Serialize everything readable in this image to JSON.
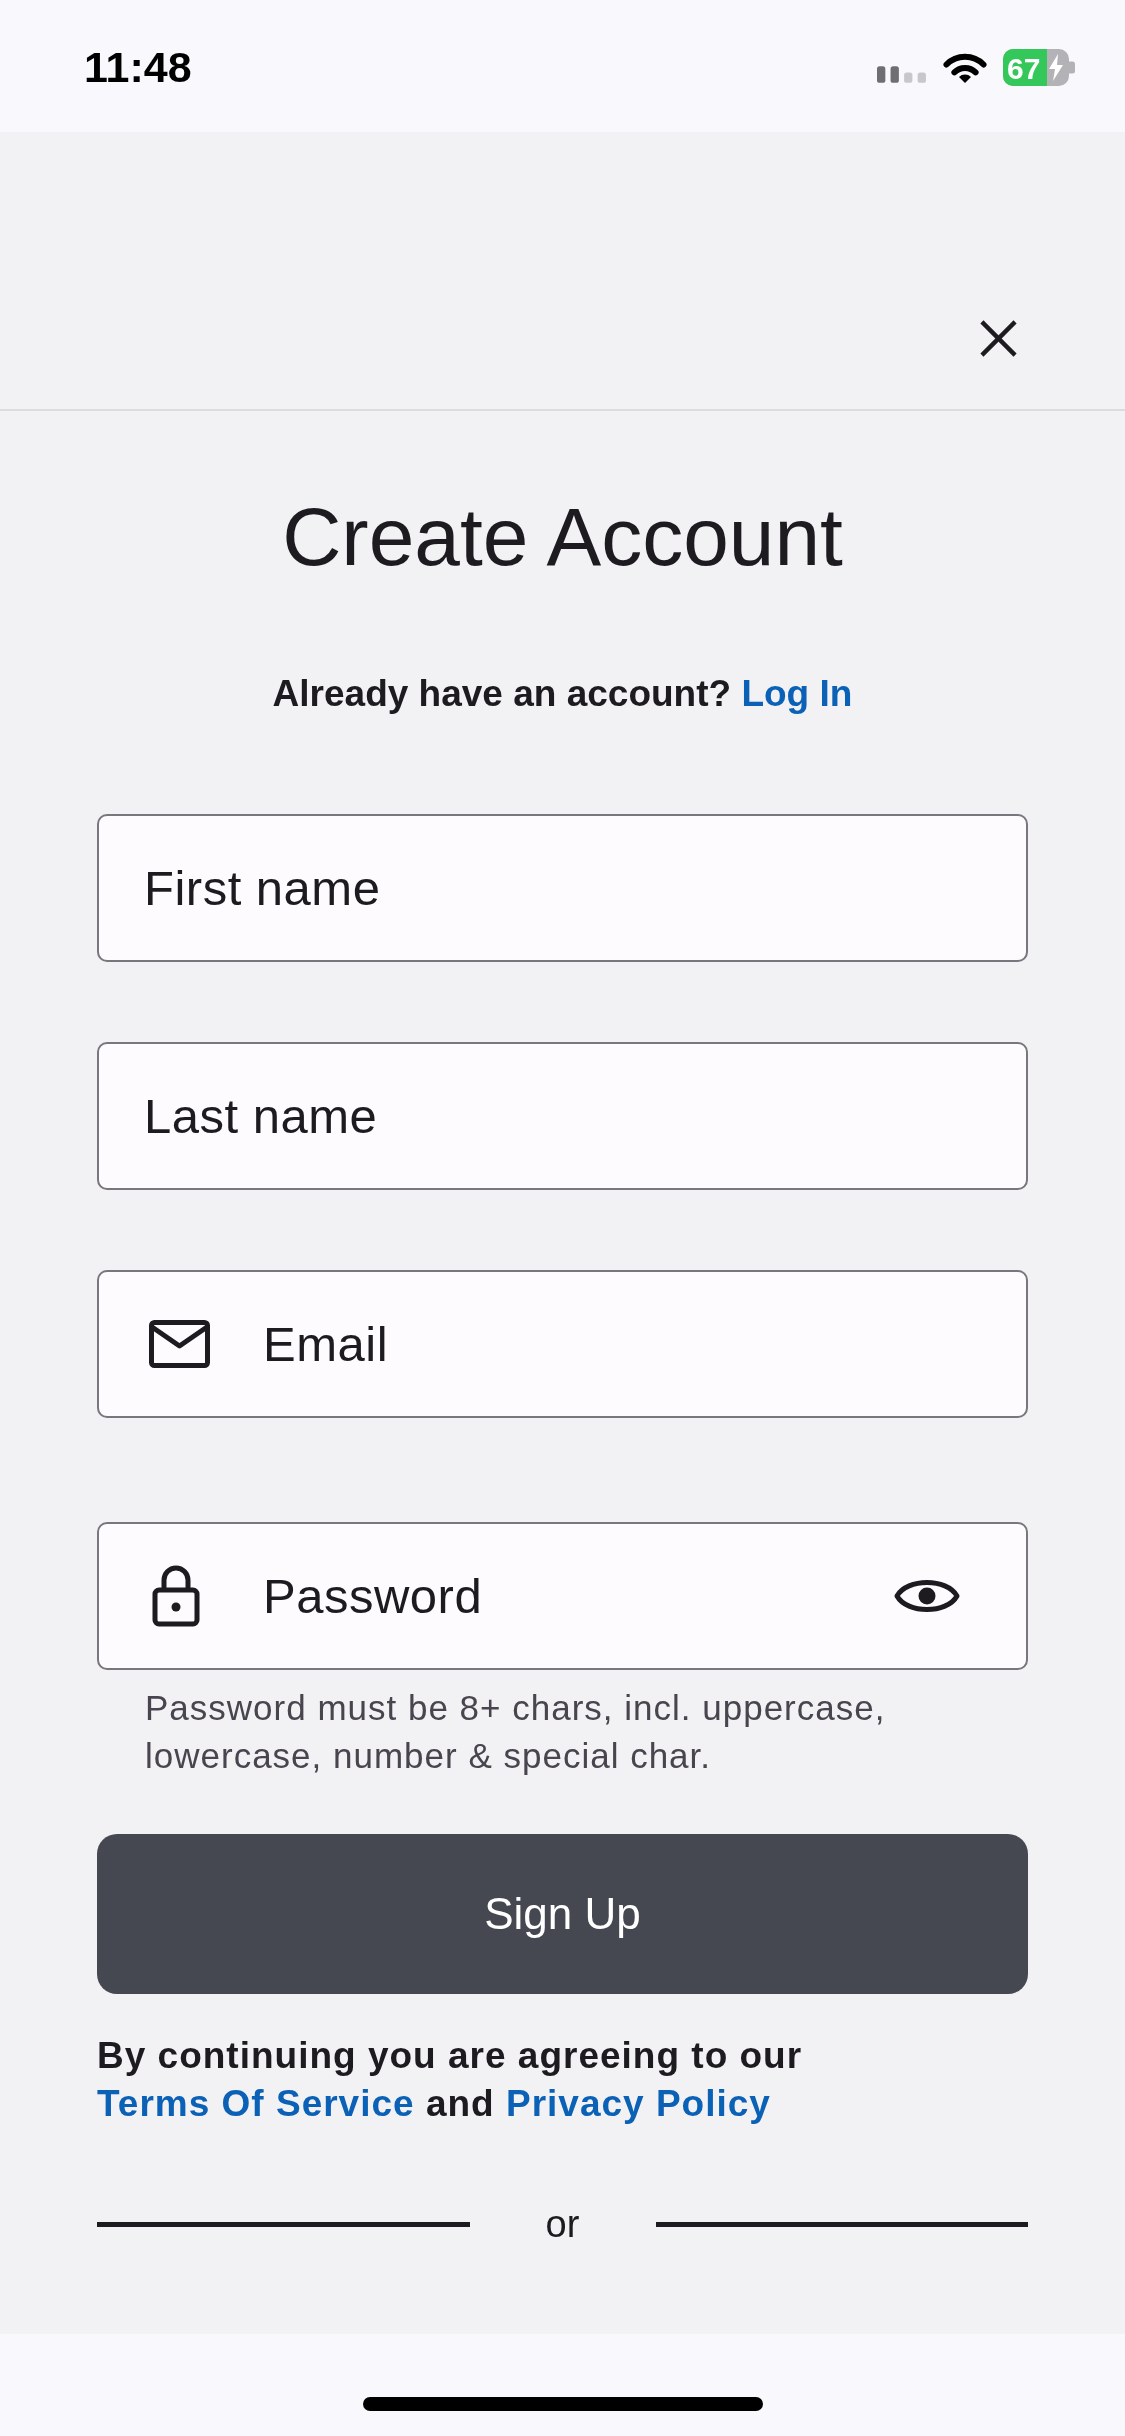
{
  "status_bar": {
    "time": "11:48",
    "battery": "67",
    "charging": true
  },
  "title": "Create Account",
  "login_prompt": {
    "text": "Already have an account?",
    "link": "Log In"
  },
  "fields": [
    {
      "kind": "text",
      "placeholder": "First name"
    },
    {
      "kind": "text",
      "placeholder": "Last name"
    },
    {
      "kind": "email",
      "placeholder": "Email"
    },
    {
      "kind": "password",
      "placeholder": "Password",
      "helper": "Password must be 8+ chars, incl. uppercase, lowercase, number & special char."
    }
  ],
  "sign_up_button": "Sign Up",
  "terms": {
    "prefix": "By continuing you are agreeing to our",
    "terms_link": "Terms Of Service",
    "joiner": "and",
    "privacy_link": "Privacy Policy"
  },
  "divider": {
    "label": "or"
  }
}
